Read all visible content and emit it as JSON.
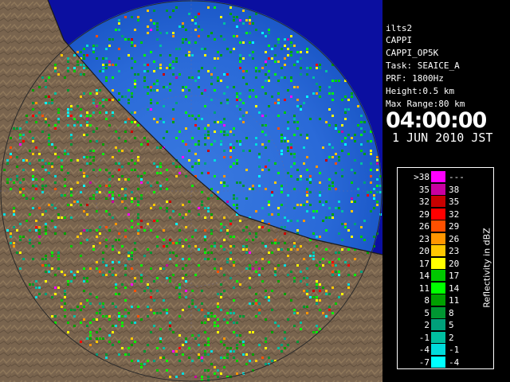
{
  "radar": {
    "station": "ilts2",
    "product": "CAPPI",
    "product_name": "CAPPI_OP5K",
    "task": "Task: SEAICE_A",
    "prf": "PRF: 1800Hz",
    "height": "Height:0.5 km",
    "max_range": "Max Range:80 km",
    "time": "04:00:00",
    "date": "1 JUN 2010 JST"
  },
  "legend": {
    "title": "Reflectivity in dBZ",
    "rows": [
      {
        "lo": ">38",
        "hi": "---",
        "color": "#ff00ff"
      },
      {
        "lo": "35",
        "hi": "38",
        "color": "#c800a0"
      },
      {
        "lo": "32",
        "hi": "35",
        "color": "#c80000"
      },
      {
        "lo": "29",
        "hi": "32",
        "color": "#ff0000"
      },
      {
        "lo": "26",
        "hi": "29",
        "color": "#ff5000"
      },
      {
        "lo": "23",
        "hi": "26",
        "color": "#ff9600"
      },
      {
        "lo": "20",
        "hi": "23",
        "color": "#ffc800"
      },
      {
        "lo": "17",
        "hi": "20",
        "color": "#ffff00"
      },
      {
        "lo": "14",
        "hi": "17",
        "color": "#00c800"
      },
      {
        "lo": "11",
        "hi": "14",
        "color": "#00ff00"
      },
      {
        "lo": "8",
        "hi": "11",
        "color": "#00a000"
      },
      {
        "lo": "5",
        "hi": "8",
        "color": "#009632"
      },
      {
        "lo": "2",
        "hi": "5",
        "color": "#00a07a"
      },
      {
        "lo": "-1",
        "hi": "2",
        "color": "#00bfa0"
      },
      {
        "lo": "-4",
        "hi": "-1",
        "color": "#00dcdc"
      },
      {
        "lo": "-7",
        "hi": "-4",
        "color": "#00ffff"
      }
    ]
  },
  "colors": {
    "sea": "#0b0fa0",
    "land": "#6e5a46",
    "echo_field": "#1e5ad2"
  }
}
